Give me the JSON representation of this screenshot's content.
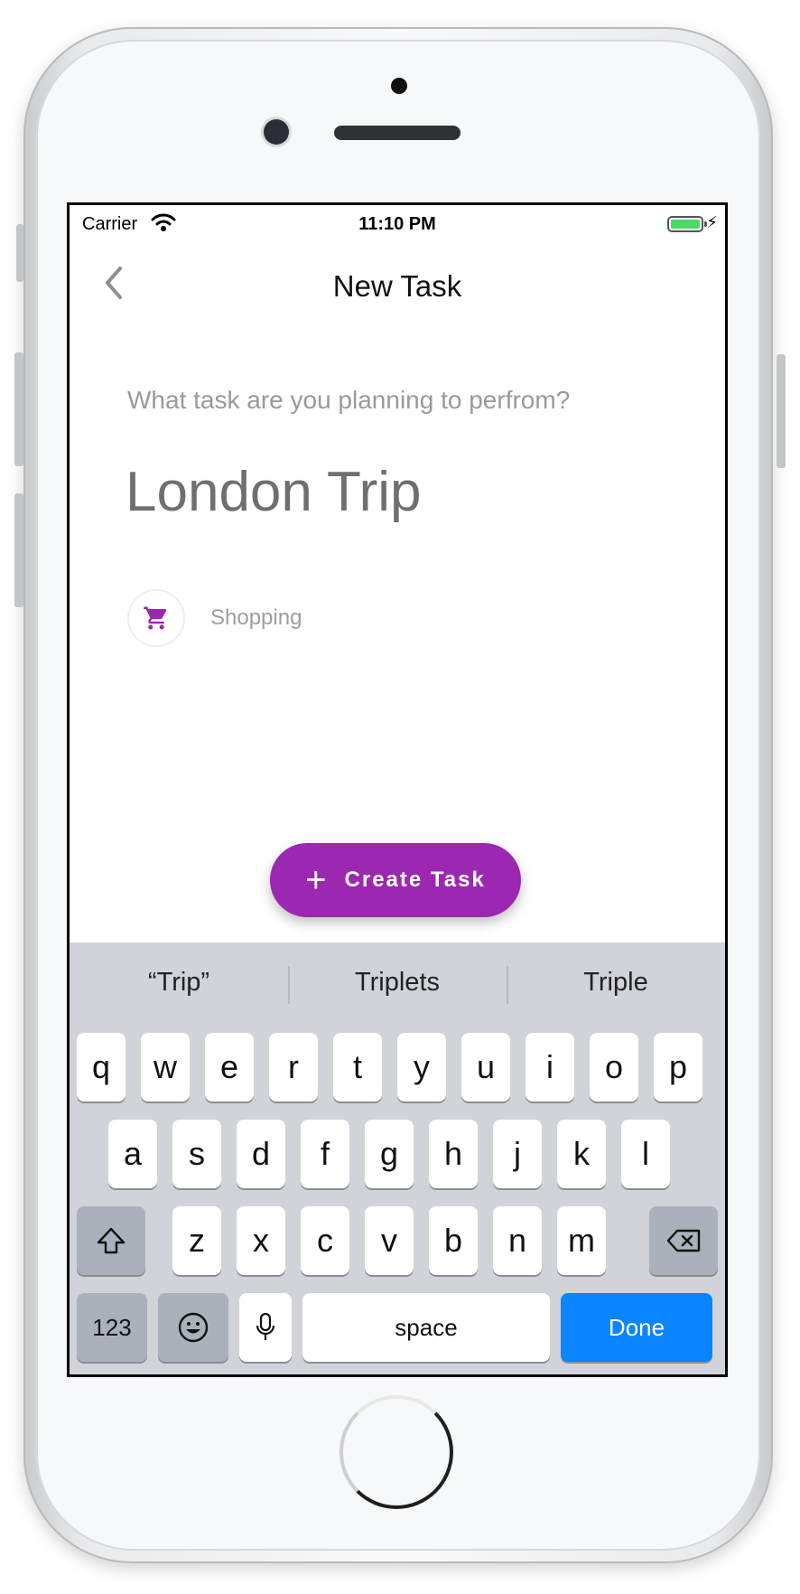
{
  "status_bar": {
    "carrier": "Carrier",
    "time": "11:10 PM"
  },
  "nav": {
    "title": "New Task"
  },
  "form": {
    "prompt": "What task are you planning to perfrom?",
    "task_name": "London Trip",
    "category_label": "Shopping"
  },
  "fab": {
    "label": "Create Task"
  },
  "keyboard": {
    "suggestions": [
      "“Trip”",
      "Triplets",
      "Triple"
    ],
    "row1": [
      "q",
      "w",
      "e",
      "r",
      "t",
      "y",
      "u",
      "i",
      "o",
      "p"
    ],
    "row2": [
      "a",
      "s",
      "d",
      "f",
      "g",
      "h",
      "j",
      "k",
      "l"
    ],
    "row3": [
      "z",
      "x",
      "c",
      "v",
      "b",
      "n",
      "m"
    ],
    "numbers_label": "123",
    "space_label": "space",
    "done_label": "Done"
  },
  "colors": {
    "accent": "#9c27b0",
    "done_key": "#0a84ff",
    "battery": "#4cd964"
  }
}
